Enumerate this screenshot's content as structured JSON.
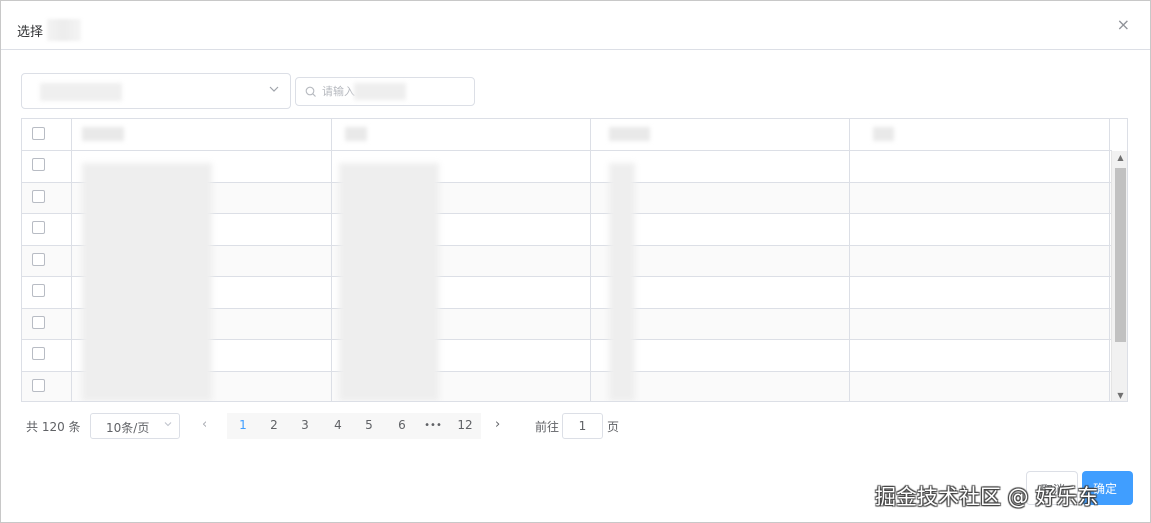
{
  "dialog": {
    "title": "选择",
    "close_glyph": "×"
  },
  "filters": {
    "select_chevron": "⌵",
    "search_placeholder": "请输入"
  },
  "table": {
    "row_count": 8,
    "has_select_all": true
  },
  "pagination": {
    "total": "共 120 条",
    "page_size": "10条/页",
    "pages": [
      "1",
      "2",
      "3",
      "4",
      "5",
      "6",
      "•••",
      "12"
    ],
    "current_page": "1",
    "goto_label": "前往",
    "goto_value": "1",
    "goto_suffix": "页",
    "prev_glyph": "‹",
    "next_glyph": "›"
  },
  "footer": {
    "cancel_label": "取消",
    "confirm_label": "确定"
  },
  "watermark": "掘金技术社区 @ 好乐东",
  "colors": {
    "accent": "#409eff",
    "border": "#dcdfe6",
    "text": "#606266"
  }
}
